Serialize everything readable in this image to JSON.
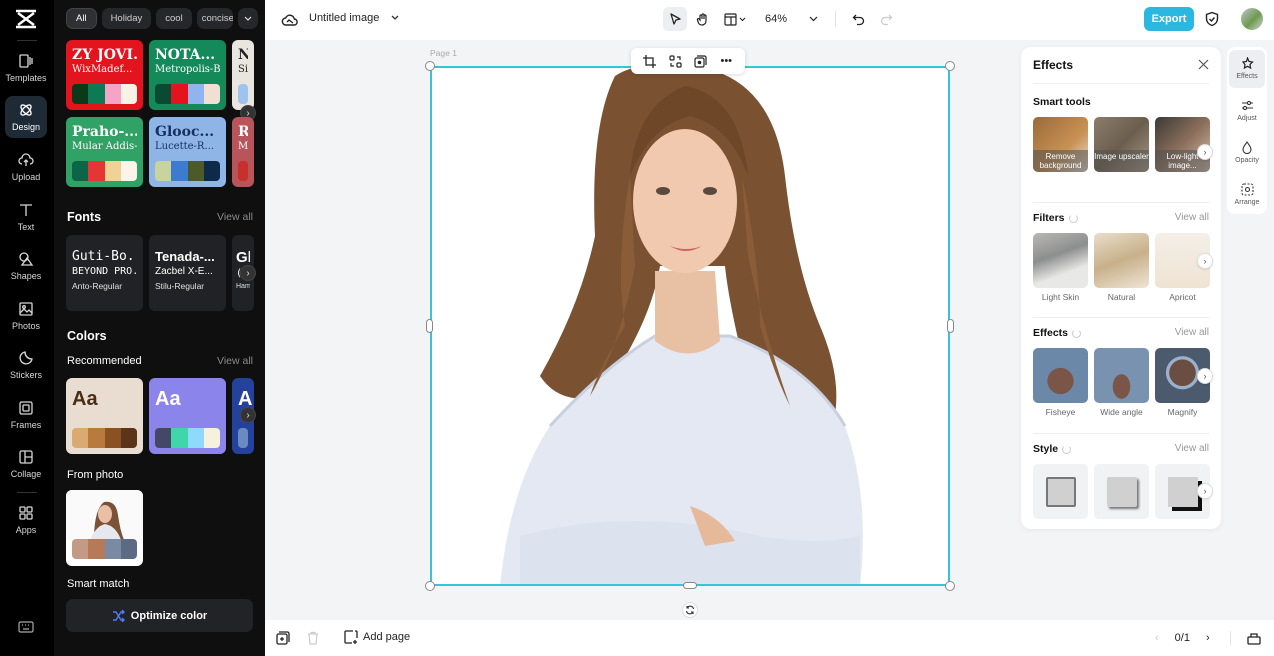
{
  "app": {
    "logo_icon": "capcut-logo-icon"
  },
  "rail": {
    "items": [
      {
        "label": "Templates",
        "icon": "templates-icon"
      },
      {
        "label": "Design",
        "icon": "design-icon",
        "active": true
      },
      {
        "label": "Upload",
        "icon": "upload-icon"
      },
      {
        "label": "Text",
        "icon": "text-icon"
      },
      {
        "label": "Shapes",
        "icon": "shapes-icon"
      },
      {
        "label": "Photos",
        "icon": "photos-icon"
      },
      {
        "label": "Stickers",
        "icon": "stickers-icon"
      },
      {
        "label": "Frames",
        "icon": "frames-icon"
      },
      {
        "label": "Collage",
        "icon": "collage-icon"
      },
      {
        "label": "Apps",
        "icon": "apps-icon"
      }
    ]
  },
  "design_panel": {
    "chips": [
      "All",
      "Holiday",
      "cool",
      "concise"
    ],
    "active_chip": "All",
    "templates": [
      {
        "title": "ZY JOVI...",
        "subtitle": "WixMadef...",
        "bg": "#e3141e",
        "fg": "#ffffff",
        "swatches": [
          "#0a3a1a",
          "#0d7a55",
          "#f5a3c7",
          "#f7f2e6"
        ]
      },
      {
        "title": "NOTA...",
        "subtitle": "Metropolis-B...",
        "bg": "#14895a",
        "fg": "#ffffff",
        "swatches": [
          "#0b4a32",
          "#e3141e",
          "#8fb4ef",
          "#efe0d3"
        ]
      },
      {
        "title": "No",
        "subtitle": "Sim",
        "bg": "#e8e6df",
        "fg": "#222222",
        "swatches": [
          "#9fc3ef",
          "#9fc3ef",
          "#9fc3ef",
          "#9fc3ef"
        ]
      },
      {
        "title": "Praho-...",
        "subtitle": "Mular Addis-...",
        "bg": "#31a266",
        "fg": "#ffffff",
        "swatches": [
          "#0c6449",
          "#e63535",
          "#f0d296",
          "#faf5e8"
        ]
      },
      {
        "title": "Glooc...",
        "subtitle": "Lucette-R...",
        "bg": "#8fb4e6",
        "fg": "#13305f",
        "swatches": [
          "#c9d39e",
          "#3b7bd0",
          "#4c5a2a",
          "#0e2a4a"
        ]
      },
      {
        "title": "Ru",
        "subtitle": "Mo",
        "bg": "#b9545a",
        "fg": "#ffffff",
        "swatches": [
          "#c8302e",
          "#c8302e",
          "#c8302e",
          "#c8302e"
        ]
      }
    ],
    "fonts": {
      "title": "Fonts",
      "view_all": "View all",
      "items": [
        {
          "line1": "Guti-Bo...",
          "line2": "BEYOND PRO...",
          "line3": "Anto-Regular"
        },
        {
          "line1": "Tenada-...",
          "line2": "Zacbel X-E...",
          "line3": "Stilu-Regular"
        },
        {
          "line1": "Gl",
          "line2": "(",
          "line3": "Ham"
        }
      ]
    },
    "colors": {
      "title": "Colors",
      "recommended_label": "Recommended",
      "view_all": "View all",
      "palettes": [
        {
          "sample": "Aa",
          "bg": "#e8ddd0",
          "fg": "#4a2e14",
          "swatches": [
            "#d9aa72",
            "#b87a3d",
            "#8a5222",
            "#5a3518"
          ]
        },
        {
          "sample": "Aa",
          "bg": "#8b84ea",
          "fg": "#ffffff",
          "swatches": [
            "#444866",
            "#3fd6a9",
            "#8fd8ff",
            "#f6f1dd"
          ]
        },
        {
          "sample": "A",
          "bg": "#24429c",
          "fg": "#ffffff",
          "swatches": [
            "#6a8ac4",
            "#6a8ac4",
            "#6a8ac4",
            "#6a8ac4"
          ]
        }
      ],
      "from_photo_label": "From photo",
      "photo_swatches": [
        "#c39a86",
        "#b77a58",
        "#7a8aa3",
        "#5d6a84"
      ],
      "smart_match_label": "Smart match",
      "optimize_label": "Optimize color"
    }
  },
  "topbar": {
    "title": "Untitled image",
    "zoom": "64%",
    "export_label": "Export"
  },
  "canvas": {
    "page_label": "Page 1"
  },
  "bottombar": {
    "add_page_label": "Add page",
    "page_counter": "0/1"
  },
  "effects_panel": {
    "title": "Effects",
    "smart_tools": {
      "title": "Smart tools",
      "items": [
        {
          "label": "Remove background"
        },
        {
          "label": "Image upscaler"
        },
        {
          "label": "Low-light image..."
        }
      ]
    },
    "filters": {
      "title": "Filters",
      "view_all": "View all",
      "items": [
        {
          "label": "Light Skin"
        },
        {
          "label": "Natural"
        },
        {
          "label": "Apricot"
        }
      ]
    },
    "effects": {
      "title": "Effects",
      "view_all": "View all",
      "items": [
        {
          "label": "Fisheye"
        },
        {
          "label": "Wide angle"
        },
        {
          "label": "Magnify"
        }
      ]
    },
    "style": {
      "title": "Style",
      "view_all": "View all"
    }
  },
  "tool_rail": {
    "items": [
      {
        "label": "Effects",
        "active": true
      },
      {
        "label": "Adjust"
      },
      {
        "label": "Opacity"
      },
      {
        "label": "Arrange"
      }
    ]
  },
  "colors": {
    "accent": "#2bb8e0",
    "selection": "#34c6d6",
    "panel_bg": "#0f0f10"
  }
}
